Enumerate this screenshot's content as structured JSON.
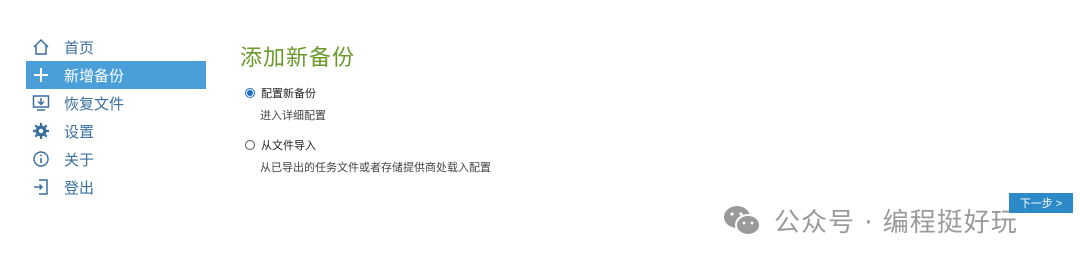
{
  "sidebar": {
    "items": [
      {
        "label": "首页",
        "icon": "home-icon",
        "active": false
      },
      {
        "label": "新增备份",
        "icon": "plus-icon",
        "active": true
      },
      {
        "label": "恢复文件",
        "icon": "restore-icon",
        "active": false
      },
      {
        "label": "设置",
        "icon": "gear-icon",
        "active": false
      },
      {
        "label": "关于",
        "icon": "info-icon",
        "active": false
      },
      {
        "label": "登出",
        "icon": "logout-icon",
        "active": false
      }
    ]
  },
  "main": {
    "title": "添加新备份",
    "options": [
      {
        "title": "配置新备份",
        "desc": "进入详细配置",
        "checked": true
      },
      {
        "title": "从文件导入",
        "desc": "从已导出的任务文件或者存储提供商处载入配置",
        "checked": false
      }
    ],
    "next_label": "下一步 >"
  },
  "watermark": {
    "text": "公众号 · 编程挺好玩",
    "icon": "wechat-icon"
  },
  "colors": {
    "accent": "#4a9fd8",
    "title": "#6a9a2a",
    "nav_text": "#3a6f9e",
    "button": "#2c8ac8"
  }
}
